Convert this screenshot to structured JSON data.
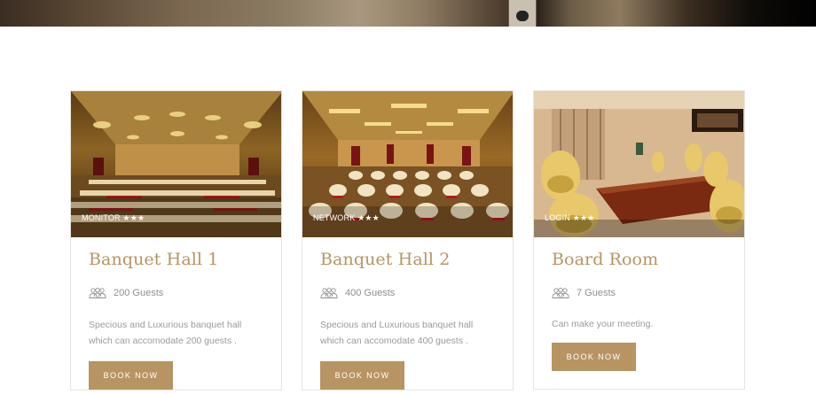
{
  "colors": {
    "accent": "#b89462",
    "text_muted": "#9a9a9a",
    "border": "#e9e4dc"
  },
  "cards": [
    {
      "tag": "MONITOR ★★★",
      "title": "Banquet Hall 1",
      "guests": "200 Guests",
      "guests_icon": "people-icon",
      "description": "Specious and Luxurious banquet hall which can accomodate 200 guests .",
      "button": "BOOK NOW"
    },
    {
      "tag": "NETWORK ★★★",
      "title": "Banquet Hall 2",
      "guests": "400 Guests",
      "guests_icon": "people-icon",
      "description": "Specious and Luxurious banquet hall which can accomodate 400 guests .",
      "button": "BOOK NOW"
    },
    {
      "tag": "LOGIN ★★★",
      "title": "Board Room",
      "guests": "7 Guests",
      "guests_icon": "people-icon",
      "description": "Can make your meeting.",
      "button": "BOOK NOW"
    }
  ]
}
